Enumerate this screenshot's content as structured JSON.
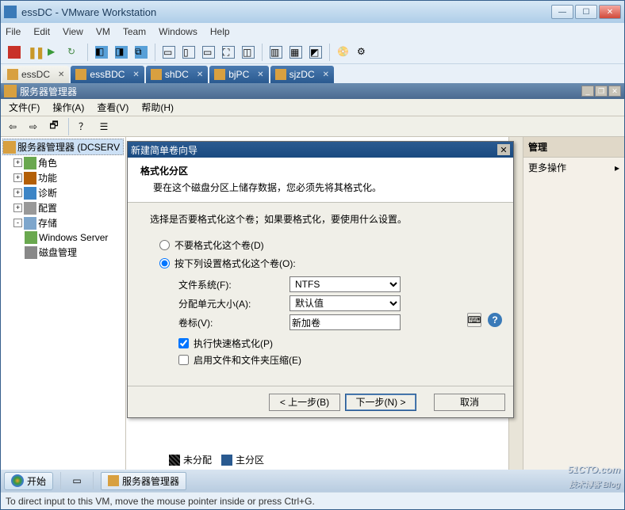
{
  "vmware": {
    "title": "essDC - VMware Workstation",
    "menus": [
      "File",
      "Edit",
      "View",
      "VM",
      "Team",
      "Windows",
      "Help"
    ],
    "tabs": [
      {
        "label": "essDC",
        "active": true
      },
      {
        "label": "essBDC",
        "active": false
      },
      {
        "label": "shDC",
        "active": false
      },
      {
        "label": "bjPC",
        "active": false
      },
      {
        "label": "sjzDC",
        "active": false
      }
    ],
    "status": "To direct input to this VM, move the mouse pointer inside or press Ctrl+G."
  },
  "guest": {
    "app_title": "服务器管理器",
    "menus": [
      "文件(F)",
      "操作(A)",
      "查看(V)",
      "帮助(H)"
    ],
    "tree_root": "服务器管理器 (DCSERV",
    "tree": [
      "角色",
      "功能",
      "诊断",
      "配置",
      "存储"
    ],
    "storage_children": [
      "Windows Server",
      "磁盘管理"
    ],
    "side_head": "管理",
    "side_item": "更多操作",
    "legend": {
      "unalloc": "未分配",
      "primary": "主分区"
    },
    "taskbar": {
      "start": "开始",
      "app": "服务器管理器"
    }
  },
  "wizard": {
    "title": "新建简单卷向导",
    "header": "格式化分区",
    "subheader": "要在这个磁盘分区上储存数据，您必须先将其格式化。",
    "intro": "选择是否要格式化这个卷；如果要格式化，要使用什么设置。",
    "opt_noformat": "不要格式化这个卷(D)",
    "opt_format": "按下列设置格式化这个卷(O):",
    "fs_label": "文件系统(F):",
    "fs_value": "NTFS",
    "alloc_label": "分配单元大小(A):",
    "alloc_value": "默认值",
    "vol_label": "卷标(V):",
    "vol_value": "新加卷",
    "quick": "执行快速格式化(P)",
    "compress": "启用文件和文件夹压缩(E)",
    "btn_back": "< 上一步(B)",
    "btn_next": "下一步(N) >",
    "btn_cancel": "取消"
  },
  "watermark": {
    "main": "51CTO.com",
    "sub": "技术博客 Blog"
  }
}
